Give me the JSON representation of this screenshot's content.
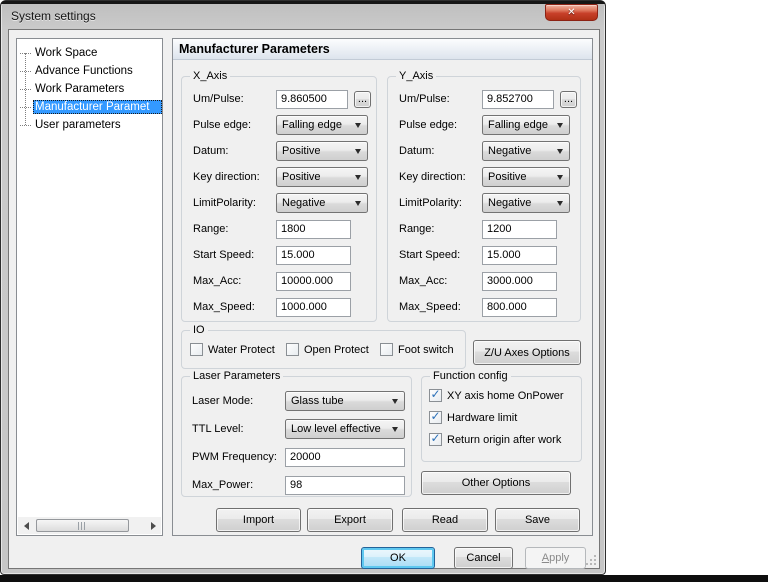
{
  "window": {
    "title": "System settings",
    "close_icon": "✕"
  },
  "colors": {
    "selection_blue": "#3399ff",
    "close_button_red": "#c8402a",
    "default_button_glow": "#5fc8f0",
    "dialog_face": "#f0f0f0"
  },
  "tree": {
    "items": [
      {
        "label": "Work Space",
        "selected": false
      },
      {
        "label": "Advance Functions",
        "selected": false
      },
      {
        "label": "Work Parameters",
        "selected": false
      },
      {
        "label": "Manufacturer Paramet",
        "selected": true
      },
      {
        "label": "User parameters",
        "selected": false
      }
    ]
  },
  "main": {
    "header": "Manufacturer Parameters",
    "x_axis": {
      "title": "X_Axis",
      "um_pulse": {
        "label": "Um/Pulse:",
        "value": "9.860500",
        "browse": "..."
      },
      "pulse_edge": {
        "label": "Pulse edge:",
        "value": "Falling edge"
      },
      "datum": {
        "label": "Datum:",
        "value": "Positive"
      },
      "key_direction": {
        "label": "Key direction:",
        "value": "Positive"
      },
      "limit_polarity": {
        "label": "LimitPolarity:",
        "value": "Negative"
      },
      "range": {
        "label": "Range:",
        "value": "1800"
      },
      "start_speed": {
        "label": "Start Speed:",
        "value": "15.000"
      },
      "max_acc": {
        "label": "Max_Acc:",
        "value": "10000.000"
      },
      "max_speed": {
        "label": "Max_Speed:",
        "value": "1000.000"
      }
    },
    "y_axis": {
      "title": "Y_Axis",
      "um_pulse": {
        "label": "Um/Pulse:",
        "value": "9.852700",
        "browse": "..."
      },
      "pulse_edge": {
        "label": "Pulse edge:",
        "value": "Falling edge"
      },
      "datum": {
        "label": "Datum:",
        "value": "Negative"
      },
      "key_direction": {
        "label": "Key direction:",
        "value": "Positive"
      },
      "limit_polarity": {
        "label": "LimitPolarity:",
        "value": "Negative"
      },
      "range": {
        "label": "Range:",
        "value": "1200"
      },
      "start_speed": {
        "label": "Start Speed:",
        "value": "15.000"
      },
      "max_acc": {
        "label": "Max_Acc:",
        "value": "3000.000"
      },
      "max_speed": {
        "label": "Max_Speed:",
        "value": "800.000"
      }
    },
    "io": {
      "title": "IO",
      "water_protect": {
        "label": "Water Protect",
        "checked": false
      },
      "open_protect": {
        "label": "Open Protect",
        "checked": false
      },
      "foot_switch": {
        "label": "Foot switch",
        "checked": false
      }
    },
    "zu_axes_button": "Z/U Axes Options",
    "laser": {
      "title": "Laser Parameters",
      "laser_mode": {
        "label": "Laser Mode:",
        "value": "Glass tube"
      },
      "ttl_level": {
        "label": "TTL Level:",
        "value": "Low level effective"
      },
      "pwm_frequency": {
        "label": "PWM Frequency:",
        "value": "20000"
      },
      "max_power": {
        "label": "Max_Power:",
        "value": "98"
      }
    },
    "function_config": {
      "title": "Function config",
      "xy_home": {
        "label": "XY axis home OnPower",
        "checked": true
      },
      "hardware_limit": {
        "label": "Hardware limit",
        "checked": true
      },
      "return_origin": {
        "label": "Return origin after work",
        "checked": true
      }
    },
    "other_options_button": "Other Options",
    "file_buttons": {
      "import": "Import",
      "export": "Export",
      "read": "Read",
      "save": "Save"
    }
  },
  "footer": {
    "ok": "OK",
    "cancel": "Cancel",
    "apply": "Apply"
  }
}
